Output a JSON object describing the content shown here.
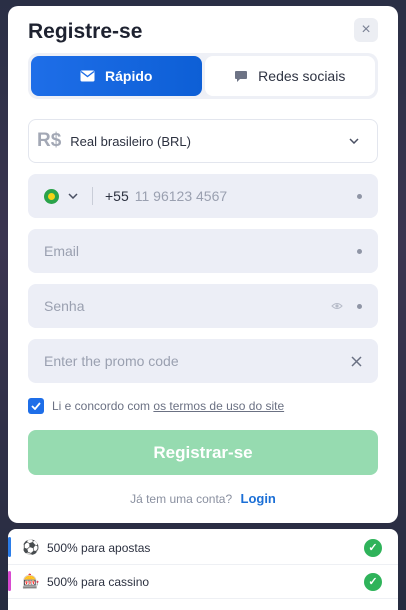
{
  "modal": {
    "title": "Registre-se",
    "close_icon": "×",
    "tabs": [
      {
        "label": "Rápido",
        "icon": "envelope-icon",
        "active": true
      },
      {
        "label": "Redes sociais",
        "icon": "chat-bubble-icon",
        "active": false
      }
    ]
  },
  "form": {
    "currency": {
      "symbol": "R$",
      "value": "Real brasileiro (BRL)"
    },
    "phone": {
      "country_code": "+55",
      "placeholder": "11 96123 4567"
    },
    "email": {
      "placeholder": "Email"
    },
    "password": {
      "placeholder": "Senha"
    },
    "promo": {
      "placeholder": "Enter the promo code"
    },
    "terms": {
      "prefix": "Li e concordo com ",
      "link": "os termos de uso do site",
      "checked": true
    },
    "register_label": "Registrar-se",
    "login_prompt": "Já tem uma conta?",
    "login_label": "Login"
  },
  "bonuses": [
    {
      "label": "500% para apostas",
      "emoji": "⚽",
      "bar_color": "#2b7de9"
    },
    {
      "label": "500% para cassino",
      "emoji": "🎰",
      "bar_color": "#d84ad0"
    }
  ],
  "colors": {
    "accent": "#1e6ee8",
    "register_button": "#96dbb0",
    "check": "#2fb35a"
  }
}
